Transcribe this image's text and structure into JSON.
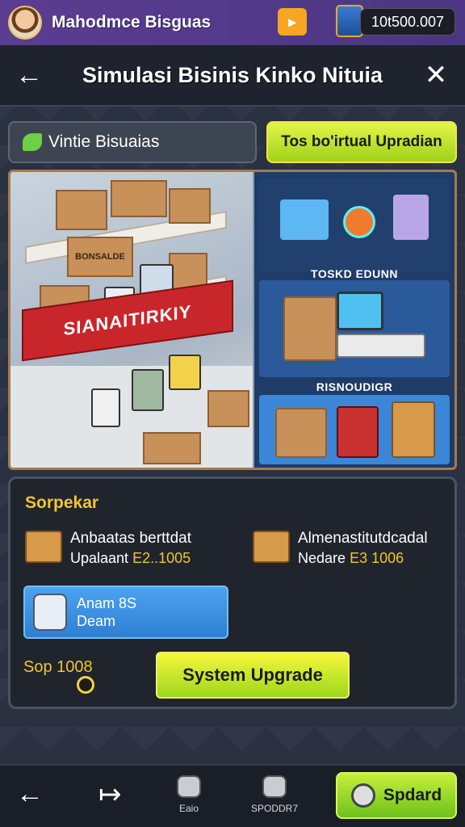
{
  "topbar": {
    "player_name": "Mahodmce Bisguas",
    "badge_icon": "ticket-icon",
    "badge_text": "▸",
    "currency": "10t500.007"
  },
  "header": {
    "title": "Simulasi Bisinis Kinko Nituia",
    "back_icon": "←",
    "close_icon": "✕"
  },
  "tabs": {
    "inactive": "Vintie Bisuaias",
    "active": "Tos bo'irtual Upradian"
  },
  "scene": {
    "store_sign": "SIANAITIRKIY",
    "box_label": "BONSALDE",
    "panel_labels": [
      "TOSKD EDUNN",
      "RISNOUDIGR"
    ]
  },
  "stats": {
    "title": "Sorpekar",
    "items": [
      {
        "name": "Anbaatas berttdat",
        "sub_label": "Upalaant",
        "amount": "E2..1005"
      },
      {
        "name": "Almenastitutdcadal",
        "sub_label": "Nedare",
        "amount": "E3 1006"
      }
    ],
    "card": {
      "line1": "Anam 8S",
      "line2": "Deam"
    },
    "cost_line1": "Sop 1008",
    "cost_line2": "",
    "upgrade_button": "System Upgrade"
  },
  "bottom_nav": {
    "back": "←",
    "forward": "↦",
    "items": [
      {
        "label": "Eaio",
        "icon": "store-icon"
      },
      {
        "label": "SPODDR7",
        "icon": "robot-icon"
      }
    ],
    "action_button": "Spdard"
  },
  "colors": {
    "topbar": "#5b3d91",
    "accent_green": "#9fd21a",
    "accent_yellow": "#f2c52e",
    "panel_dark": "#20242c"
  }
}
